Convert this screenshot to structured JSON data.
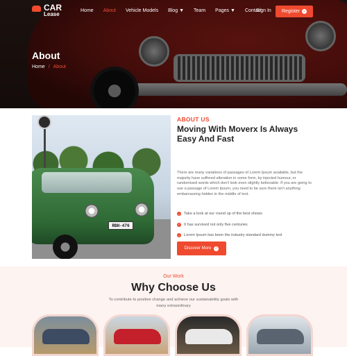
{
  "brand": {
    "line1": "CAR",
    "line2": "Lease"
  },
  "nav": {
    "items": [
      {
        "label": "Home",
        "active": false,
        "dropdown": false
      },
      {
        "label": "About",
        "active": true,
        "dropdown": false
      },
      {
        "label": "Vehicle Models",
        "active": false,
        "dropdown": false
      },
      {
        "label": "Blog",
        "active": false,
        "dropdown": true
      },
      {
        "label": "Team",
        "active": false,
        "dropdown": false
      },
      {
        "label": "Pages",
        "active": false,
        "dropdown": true
      },
      {
        "label": "Contact",
        "active": false,
        "dropdown": false
      }
    ],
    "signin": "Sign In",
    "register": "Register"
  },
  "hero": {
    "title": "About",
    "breadcrumb_home": "Home",
    "breadcrumb_sep": "/",
    "breadcrumb_current": "About"
  },
  "about": {
    "tag": "ABOUT US",
    "heading": "Moving With Moverx Is Always Easy And Fast",
    "paragraph": "There are many variations of passages of Lorem Ipsum available, but the majority have suffered alteration in some form, by injected humour, or randomised words which don't look even slightly believable. If you are going to use a passage of Lorem Ipsum, you need to be sure there isn't anything embarrassing hidden in the middle of text.",
    "list": [
      "Take a look at our round up of the best shows",
      "It has survived not only five centuries",
      "Lorem Ipsum has been the industry standard dummy text"
    ],
    "button": "Discover More",
    "plate": "RBH-476"
  },
  "why": {
    "subtitle": "Our Work",
    "title": "Why Choose Us",
    "description": "To contribute to positive change and achieve our sustainability goals with many extraordinary"
  },
  "colors": {
    "accent": "#ef4a2f",
    "section_bg": "#fdf3f1"
  }
}
